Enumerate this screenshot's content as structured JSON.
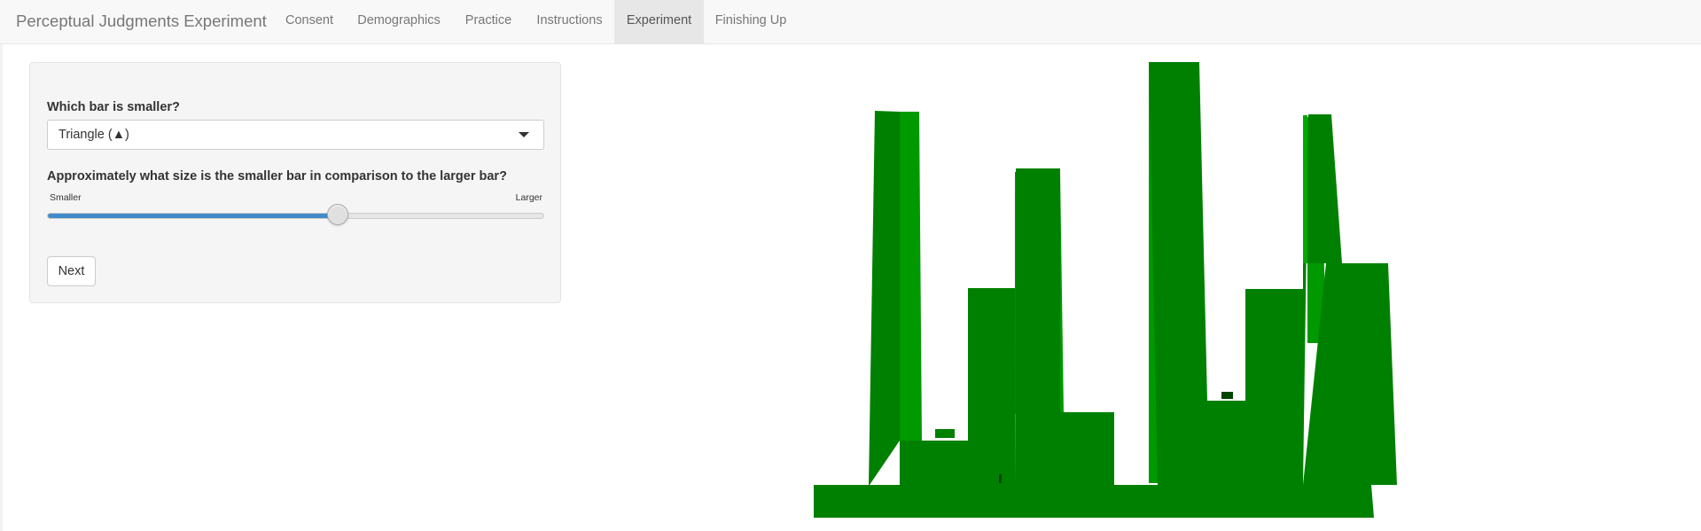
{
  "navbar": {
    "brand": "Perceptual Judgments Experiment",
    "tabs": [
      {
        "label": "Consent",
        "active": false
      },
      {
        "label": "Demographics",
        "active": false
      },
      {
        "label": "Practice",
        "active": false
      },
      {
        "label": "Instructions",
        "active": false
      },
      {
        "label": "Experiment",
        "active": true
      },
      {
        "label": "Finishing Up",
        "active": false
      }
    ]
  },
  "form": {
    "question1": "Which bar is smaller?",
    "select_value": "Triangle (▲)",
    "question2": "Approximately what size is the smaller bar in comparison to the larger bar?",
    "slider_min_label": "Smaller",
    "slider_max_label": "Larger",
    "slider_value_fraction": 0.585,
    "next_label": "Next"
  },
  "colors": {
    "bar_front": "#008000",
    "bar_side": "#009900",
    "bar_top": "#00aa00",
    "marker_dark": "#004400",
    "accent": "#428bca"
  },
  "icons": {
    "select_caret": "caret-down-icon",
    "stimulus_marker_circle": "circle-marker-icon",
    "stimulus_marker_triangle": "triangle-marker-icon"
  }
}
